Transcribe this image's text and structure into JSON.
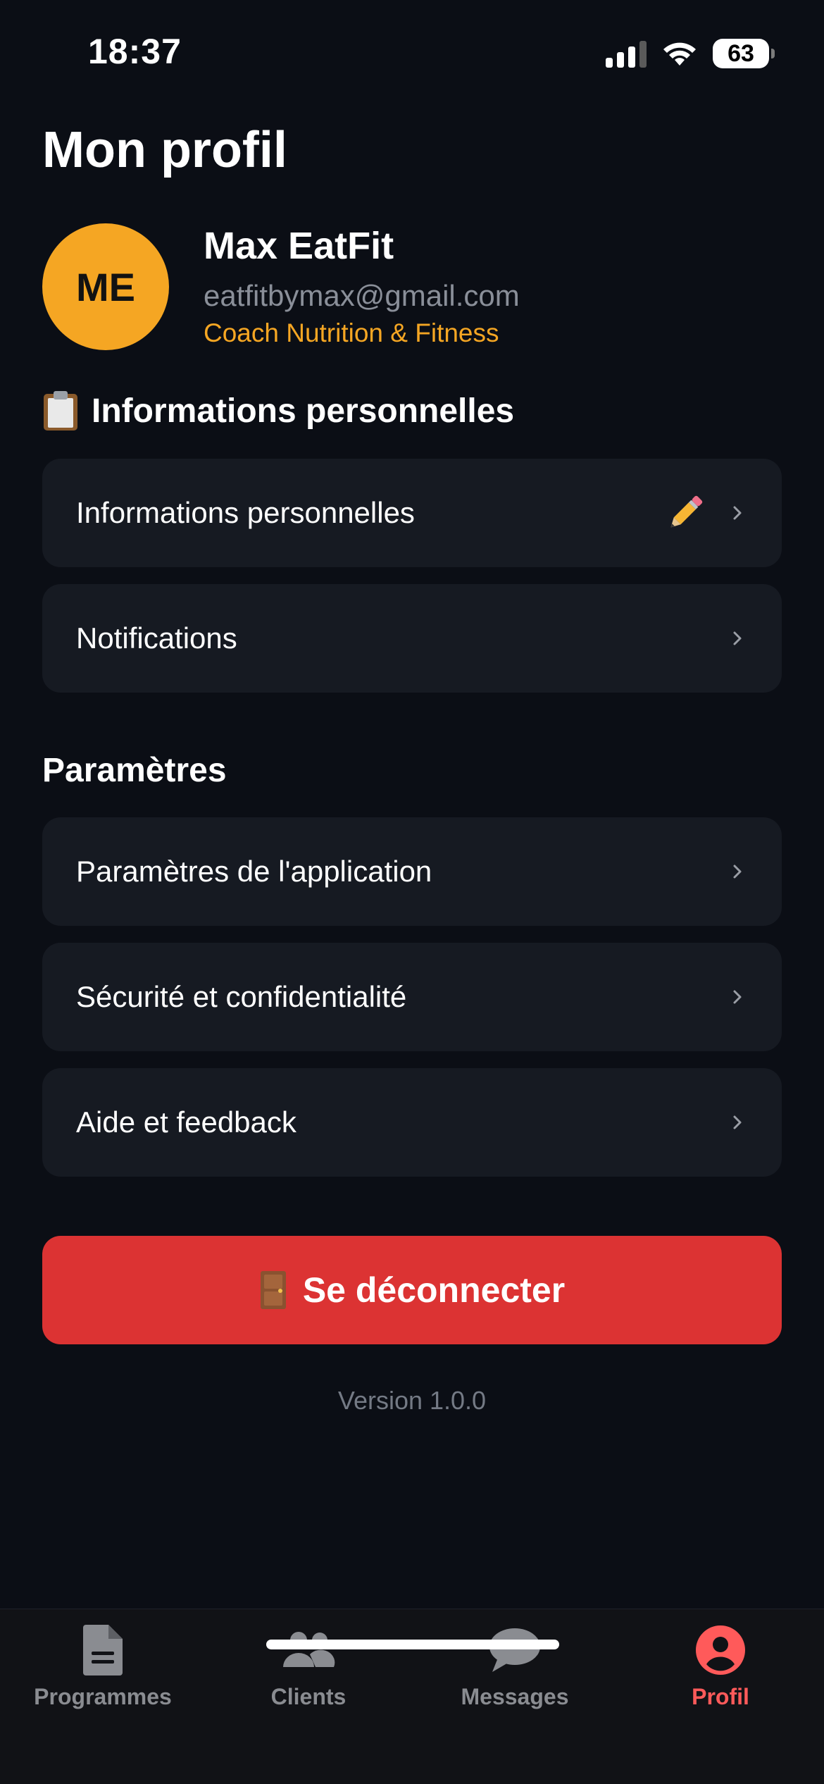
{
  "status_bar": {
    "time": "18:37",
    "battery": "63"
  },
  "page_title": "Mon profil",
  "profile": {
    "initials": "ME",
    "name": "Max EatFit",
    "email": "eatfitbymax@gmail.com",
    "role": "Coach Nutrition & Fitness",
    "avatar_color": "#f5a623"
  },
  "sections": {
    "personal": {
      "heading": "Informations personnelles",
      "heading_icon": "clipboard-icon",
      "items": [
        {
          "label": "Informations personnelles",
          "icon": "pencil-icon"
        },
        {
          "label": "Notifications"
        }
      ]
    },
    "settings": {
      "heading": "Paramètres",
      "items": [
        {
          "label": "Paramètres de l'application"
        },
        {
          "label": "Sécurité et confidentialité"
        },
        {
          "label": "Aide et feedback"
        }
      ]
    }
  },
  "logout": {
    "label": "Se déconnecter",
    "icon": "door-icon",
    "color": "#dc3333"
  },
  "version": "Version 1.0.0",
  "tabbar": {
    "tabs": [
      {
        "label": "Programmes",
        "icon": "document-icon"
      },
      {
        "label": "Clients",
        "icon": "users-icon"
      },
      {
        "label": "Messages",
        "icon": "chat-bubble-icon"
      },
      {
        "label": "Profil",
        "icon": "user-circle-icon",
        "active": true
      }
    ],
    "active_color": "#ff5a5a"
  }
}
